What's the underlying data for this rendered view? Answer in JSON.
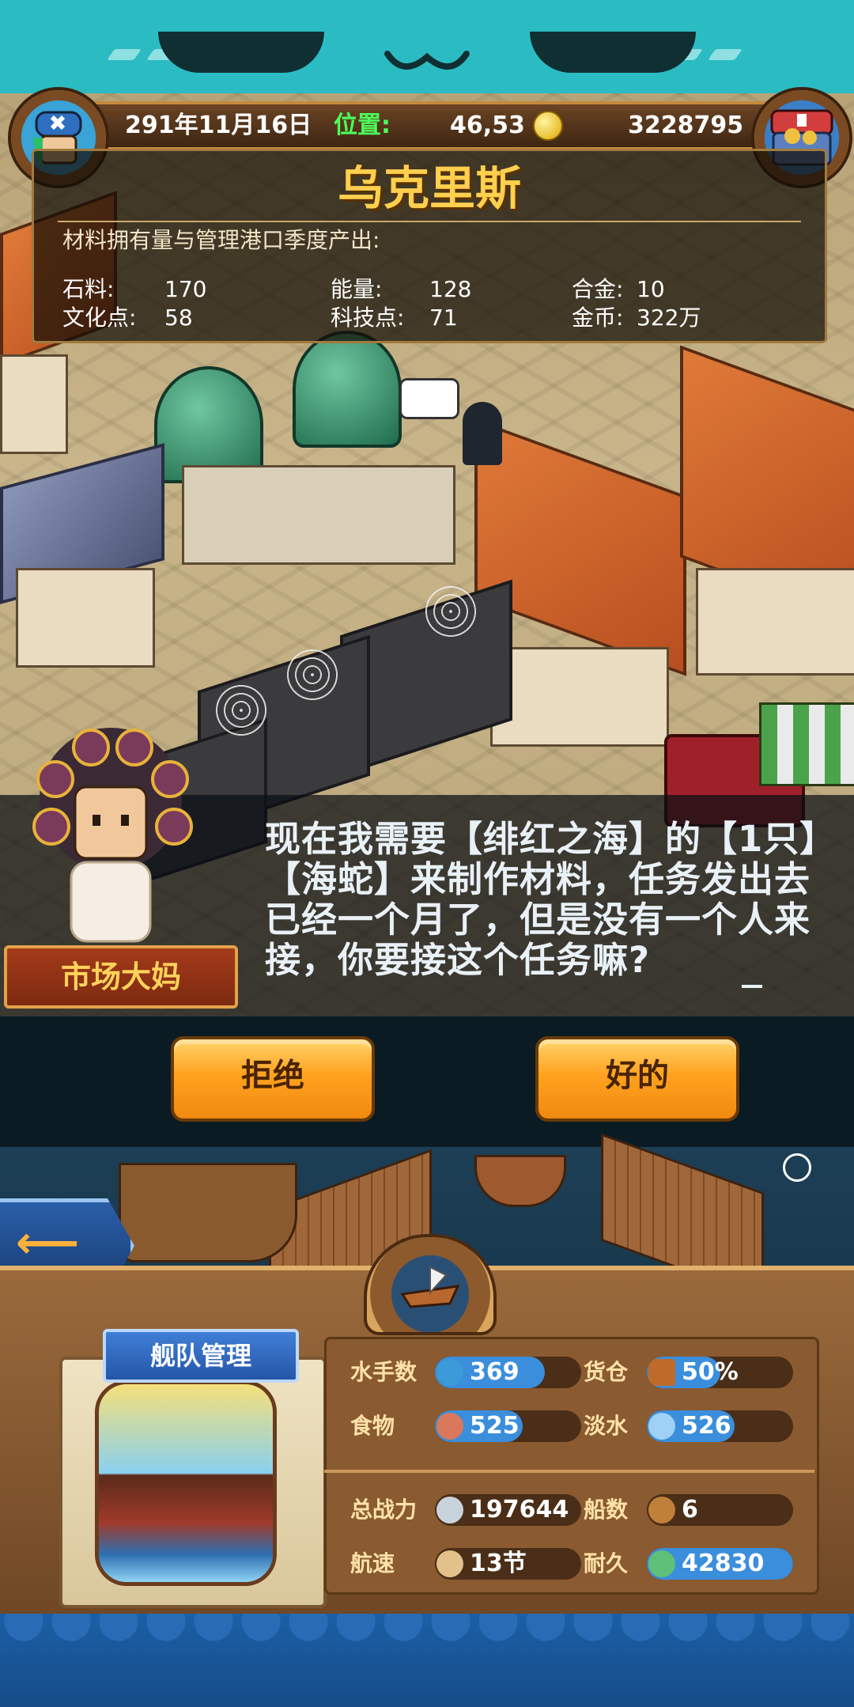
{
  "hud": {
    "date": "291年11月16日",
    "position_label": "位置:",
    "position_value": "46,53",
    "gold": "3228795"
  },
  "port": {
    "name": "乌克里斯",
    "materials_title": "材料拥有量与管理港口季度产出:",
    "resources": [
      {
        "label": "石料:",
        "value": "170"
      },
      {
        "label": "能量:",
        "value": "128"
      },
      {
        "label": "合金:",
        "value": "10"
      },
      {
        "label": "文化点:",
        "value": "58"
      },
      {
        "label": "科技点:",
        "value": "71"
      },
      {
        "label": "金币:",
        "value": "322万"
      }
    ]
  },
  "dialog": {
    "npc_name": "市场大妈",
    "text": "现在我需要【绯红之海】的【1只】【海蛇】来制作材料，任务发出去已经一个月了，但是没有一个人来接，你要接这个任务嘛?",
    "buttons": {
      "decline": "拒绝",
      "accept": "好的"
    }
  },
  "fleet": {
    "title": "舰队管理",
    "stats": [
      {
        "label": "水手数",
        "value": "369",
        "icon": "sailor-icon",
        "fill": 0.75
      },
      {
        "label": "货仓",
        "value": "50%",
        "icon": "cargo-icon",
        "fill": 0.5
      },
      {
        "label": "食物",
        "value": "525",
        "icon": "meat-icon",
        "fill": 0.6
      },
      {
        "label": "淡水",
        "value": "526",
        "icon": "water-icon",
        "fill": 0.6
      },
      {
        "label": "总战力",
        "value": "197644",
        "icon": "swords-icon",
        "fill": 0
      },
      {
        "label": "船数",
        "value": "6",
        "icon": "ship-icon",
        "fill": 0
      },
      {
        "label": "航速",
        "value": "13节",
        "icon": "sail-icon",
        "fill": 0
      },
      {
        "label": "耐久",
        "value": "42830",
        "icon": "durability-icon",
        "fill": 1.0
      }
    ]
  },
  "colors": {
    "accent": "#ffa21f",
    "title_gold": "#ffcf4d",
    "pill_blue": "#3a8edc"
  }
}
